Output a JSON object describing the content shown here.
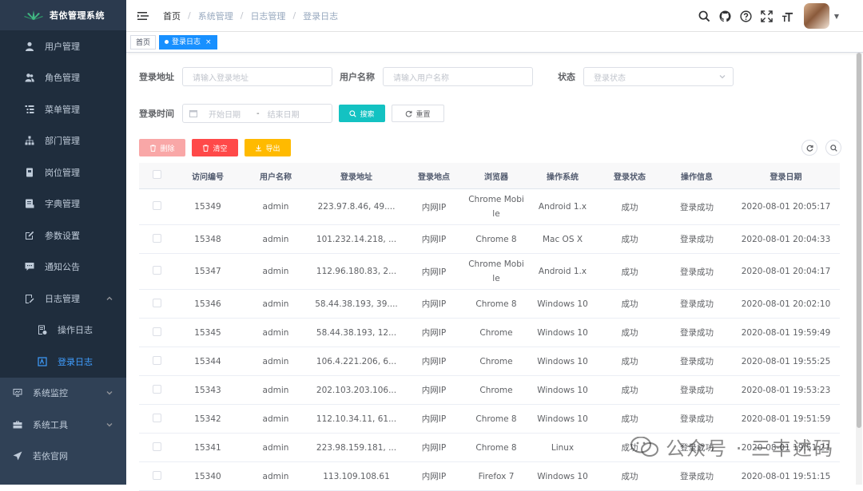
{
  "app": {
    "title": "若依管理系统"
  },
  "colors": {
    "sidebar_bg": "#304156",
    "menu_active": "#409eff",
    "tag_active": "#1890ff",
    "primary": "#13c2c2",
    "danger": "#ff4949",
    "warning": "#ffba00"
  },
  "sidebar": {
    "items": [
      {
        "label": "用户管理",
        "icon": "user-icon"
      },
      {
        "label": "角色管理",
        "icon": "peoples-icon"
      },
      {
        "label": "菜单管理",
        "icon": "tree-table-icon"
      },
      {
        "label": "部门管理",
        "icon": "tree-icon"
      },
      {
        "label": "岗位管理",
        "icon": "post-icon"
      },
      {
        "label": "字典管理",
        "icon": "dict-icon"
      },
      {
        "label": "参数设置",
        "icon": "edit-icon"
      },
      {
        "label": "通知公告",
        "icon": "message-icon"
      },
      {
        "label": "日志管理",
        "icon": "log-icon",
        "expanded": true
      },
      {
        "label": "操作日志",
        "icon": "form-icon"
      },
      {
        "label": "登录日志",
        "icon": "logininfor-icon",
        "active": true
      },
      {
        "label": "系统监控",
        "icon": "monitor-icon"
      },
      {
        "label": "系统工具",
        "icon": "tool-icon"
      },
      {
        "label": "若依官网",
        "icon": "guide-icon"
      }
    ]
  },
  "breadcrumb": [
    "首页",
    "系统管理",
    "日志管理",
    "登录日志"
  ],
  "tags": [
    {
      "label": "首页"
    },
    {
      "label": "登录日志",
      "active": true
    }
  ],
  "search": {
    "ipaddr_label": "登录地址",
    "ipaddr_placeholder": "请输入登录地址",
    "username_label": "用户名称",
    "username_placeholder": "请输入用户名称",
    "status_label": "状态",
    "status_placeholder": "登录状态",
    "time_label": "登录时间",
    "start_placeholder": "开始日期",
    "range_sep": "-",
    "end_placeholder": "结束日期",
    "search_button": "搜索",
    "reset_button": "重置"
  },
  "toolbar": {
    "delete_label": "删除",
    "clear_label": "清空",
    "export_label": "导出"
  },
  "table": {
    "columns": [
      "访问编号",
      "用户名称",
      "登录地址",
      "登录地点",
      "浏览器",
      "操作系统",
      "登录状态",
      "操作信息",
      "登录日期"
    ],
    "rows": [
      [
        "15349",
        "admin",
        "223.97.8.46, 49....",
        "内网IP",
        "Chrome Mobile",
        "Android 1.x",
        "成功",
        "登录成功",
        "2020-08-01 20:05:17"
      ],
      [
        "15348",
        "admin",
        "101.232.14.218, ...",
        "内网IP",
        "Chrome 8",
        "Mac OS X",
        "成功",
        "登录成功",
        "2020-08-01 20:04:33"
      ],
      [
        "15347",
        "admin",
        "112.96.180.83, 2...",
        "内网IP",
        "Chrome Mobile",
        "Android 1.x",
        "成功",
        "登录成功",
        "2020-08-01 20:04:17"
      ],
      [
        "15346",
        "admin",
        "58.44.38.193, 39....",
        "内网IP",
        "Chrome 8",
        "Windows 10",
        "成功",
        "登录成功",
        "2020-08-01 20:02:10"
      ],
      [
        "15345",
        "admin",
        "58.44.38.193, 12...",
        "内网IP",
        "Chrome",
        "Windows 10",
        "成功",
        "登录成功",
        "2020-08-01 19:59:49"
      ],
      [
        "15344",
        "admin",
        "106.4.221.206, 6...",
        "内网IP",
        "Chrome",
        "Windows 10",
        "成功",
        "登录成功",
        "2020-08-01 19:55:25"
      ],
      [
        "15343",
        "admin",
        "202.103.203.106...",
        "内网IP",
        "Chrome",
        "Windows 10",
        "成功",
        "登录成功",
        "2020-08-01 19:53:23"
      ],
      [
        "15342",
        "admin",
        "112.10.34.11, 61...",
        "内网IP",
        "Chrome 8",
        "Windows 10",
        "成功",
        "登录成功",
        "2020-08-01 19:51:59"
      ],
      [
        "15341",
        "admin",
        "223.98.159.181, ...",
        "内网IP",
        "Chrome 8",
        "Linux",
        "成功",
        "登录成功",
        "2020-08-01 19:51:21"
      ],
      [
        "15340",
        "admin",
        "113.109.108.61",
        "内网IP",
        "Firefox 7",
        "Windows 10",
        "成功",
        "登录成功",
        "2020-08-01 19:51:15"
      ]
    ]
  },
  "watermark": {
    "text": "公众号 · 三丰述码"
  }
}
